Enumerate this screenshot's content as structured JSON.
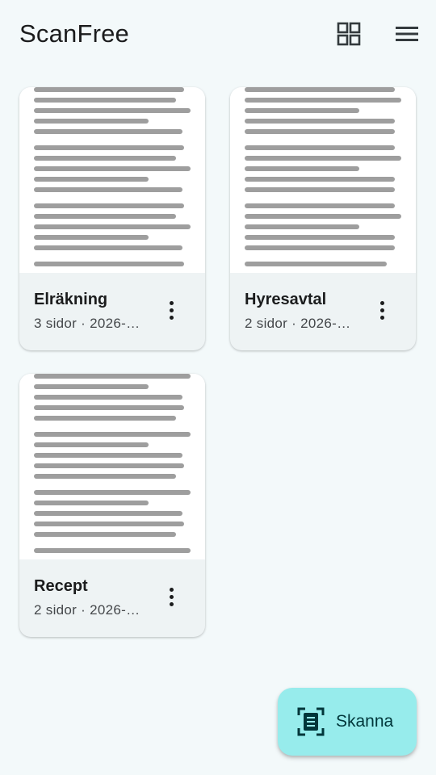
{
  "app": {
    "title": "ScanFree",
    "grid_icon": "grid-view-icon",
    "menu_icon": "hamburger-menu-icon"
  },
  "documents": [
    {
      "title": "Elräkning",
      "meta": "3 sidor · 2026-…",
      "menu_icon": "more-vert-icon"
    },
    {
      "title": "Hyresavtal",
      "meta": "2 sidor · 2026-…",
      "menu_icon": "more-vert-icon"
    },
    {
      "title": "Recept",
      "meta": "2 sidor · 2026-…",
      "menu_icon": "more-vert-icon"
    }
  ],
  "fab": {
    "label": "Skanna",
    "icon": "document-scanner-icon"
  },
  "colors": {
    "background": "#f3f9fa",
    "card": "#eef3f4",
    "fab": "#97ecec",
    "fab_text": "#00363a"
  }
}
